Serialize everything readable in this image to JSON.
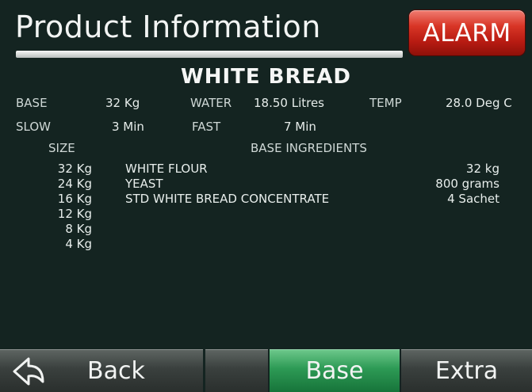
{
  "header": {
    "title": "Product Information",
    "alarm_label": "ALARM"
  },
  "product": {
    "name": "WHITE BREAD"
  },
  "params": {
    "base_label": "BASE",
    "base_value": "32 Kg",
    "water_label": "WATER",
    "water_value": "18.50 Litres",
    "temp_label": "TEMP",
    "temp_value": "28.0 Deg C",
    "slow_label": "SLOW",
    "slow_value": "3 Min",
    "fast_label": "FAST",
    "fast_value": "7 Min"
  },
  "table": {
    "size_header": "SIZE",
    "ingredients_header": "BASE INGREDIENTS",
    "sizes": [
      "32 Kg",
      "24 Kg",
      "16 Kg",
      "12 Kg",
      "8 Kg",
      "4 Kg"
    ],
    "ingredients": [
      {
        "name": "WHITE FLOUR",
        "amount": "32 kg"
      },
      {
        "name": "YEAST",
        "amount": "800 grams"
      },
      {
        "name": "STD WHITE BREAD CONCENTRATE",
        "amount": "4 Sachet"
      }
    ]
  },
  "nav": {
    "back_label": "Back",
    "base_label": "Base",
    "extra_label": "Extra",
    "back_icon": "back-arrow-icon"
  },
  "colors": {
    "alarm": "#d83526",
    "active_tab": "#2d9a55",
    "background": "#142421"
  }
}
